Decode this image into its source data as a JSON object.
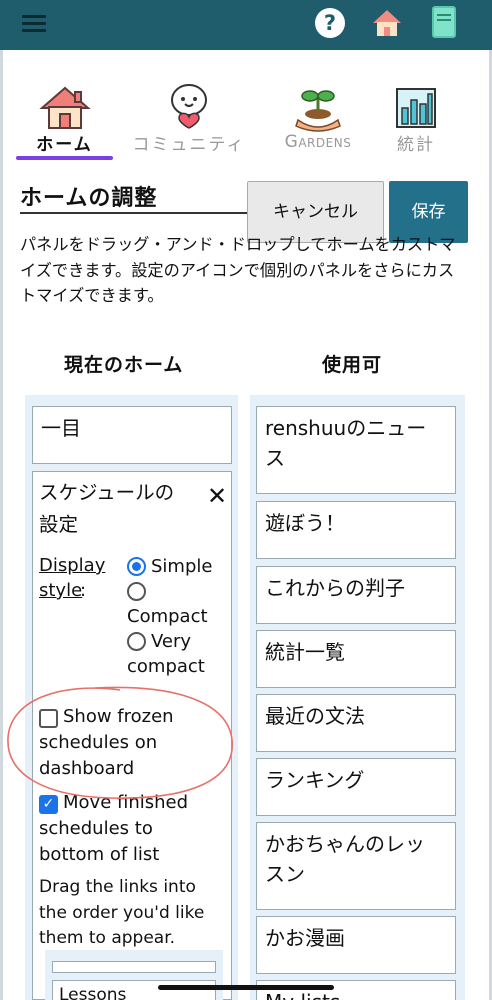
{
  "nav_tabs": [
    {
      "label": "ホーム",
      "icon": "house-icon",
      "active": true
    },
    {
      "label": "コミュニティ",
      "icon": "community-mascot-icon",
      "active": false
    },
    {
      "label": "Gardens",
      "icon": "plant-hand-icon",
      "active": false
    },
    {
      "label": "統計",
      "icon": "stats-chart-icon",
      "active": false
    }
  ],
  "header": {
    "title": "ホームの調整",
    "cancel_label": "キャンセル",
    "save_label": "保存"
  },
  "instructions": "パネルをドラッグ・アンド・ドロップしてホームをカストマイズできます。設定のアイコンで個別のパネルをさらにカストマイズできます。",
  "columns": {
    "current_heading": "現在のホーム",
    "available_heading": "使用可"
  },
  "current_home": {
    "card1": "一目",
    "schedule_panel": {
      "title_line1": "スケジュールの",
      "title_line2": "設定",
      "close": "✕",
      "display_style_label": "Display",
      "display_style_label2": "style",
      "display_style_colon": ":",
      "options": [
        {
          "label": "Simple",
          "selected": true
        },
        {
          "label": "Compact",
          "selected": false
        },
        {
          "label": "Very",
          "label2": "compact",
          "selected": false
        }
      ],
      "show_frozen": {
        "line1": "Show frozen",
        "line2": "schedules on",
        "line3": "dashboard",
        "checked": false
      },
      "move_finished": {
        "line1": "Move finished",
        "line2": "schedules to",
        "line3": "bottom of list",
        "checked": true
      },
      "drag_hint": "Drag the links into the order you'd like them to appear.",
      "sub_item": "Lessons"
    }
  },
  "available": [
    {
      "line1": "renshuuのニュー",
      "line2": "ス"
    },
    {
      "line1": "遊ぼう！"
    },
    {
      "line1": "これからの判子"
    },
    {
      "line1": "統計一覧"
    },
    {
      "line1": "最近の文法"
    },
    {
      "line1": "ランキング"
    },
    {
      "line1": "かおちゃんのレッ",
      "line2": "スン"
    },
    {
      "line1": "かお漫画"
    },
    {
      "line1": "My lists"
    }
  ],
  "colors": {
    "topbar": "#1f5c6c",
    "accent_underline": "#7b3fe4",
    "save_button": "#23708a",
    "annotation_circle": "#e8706a"
  }
}
